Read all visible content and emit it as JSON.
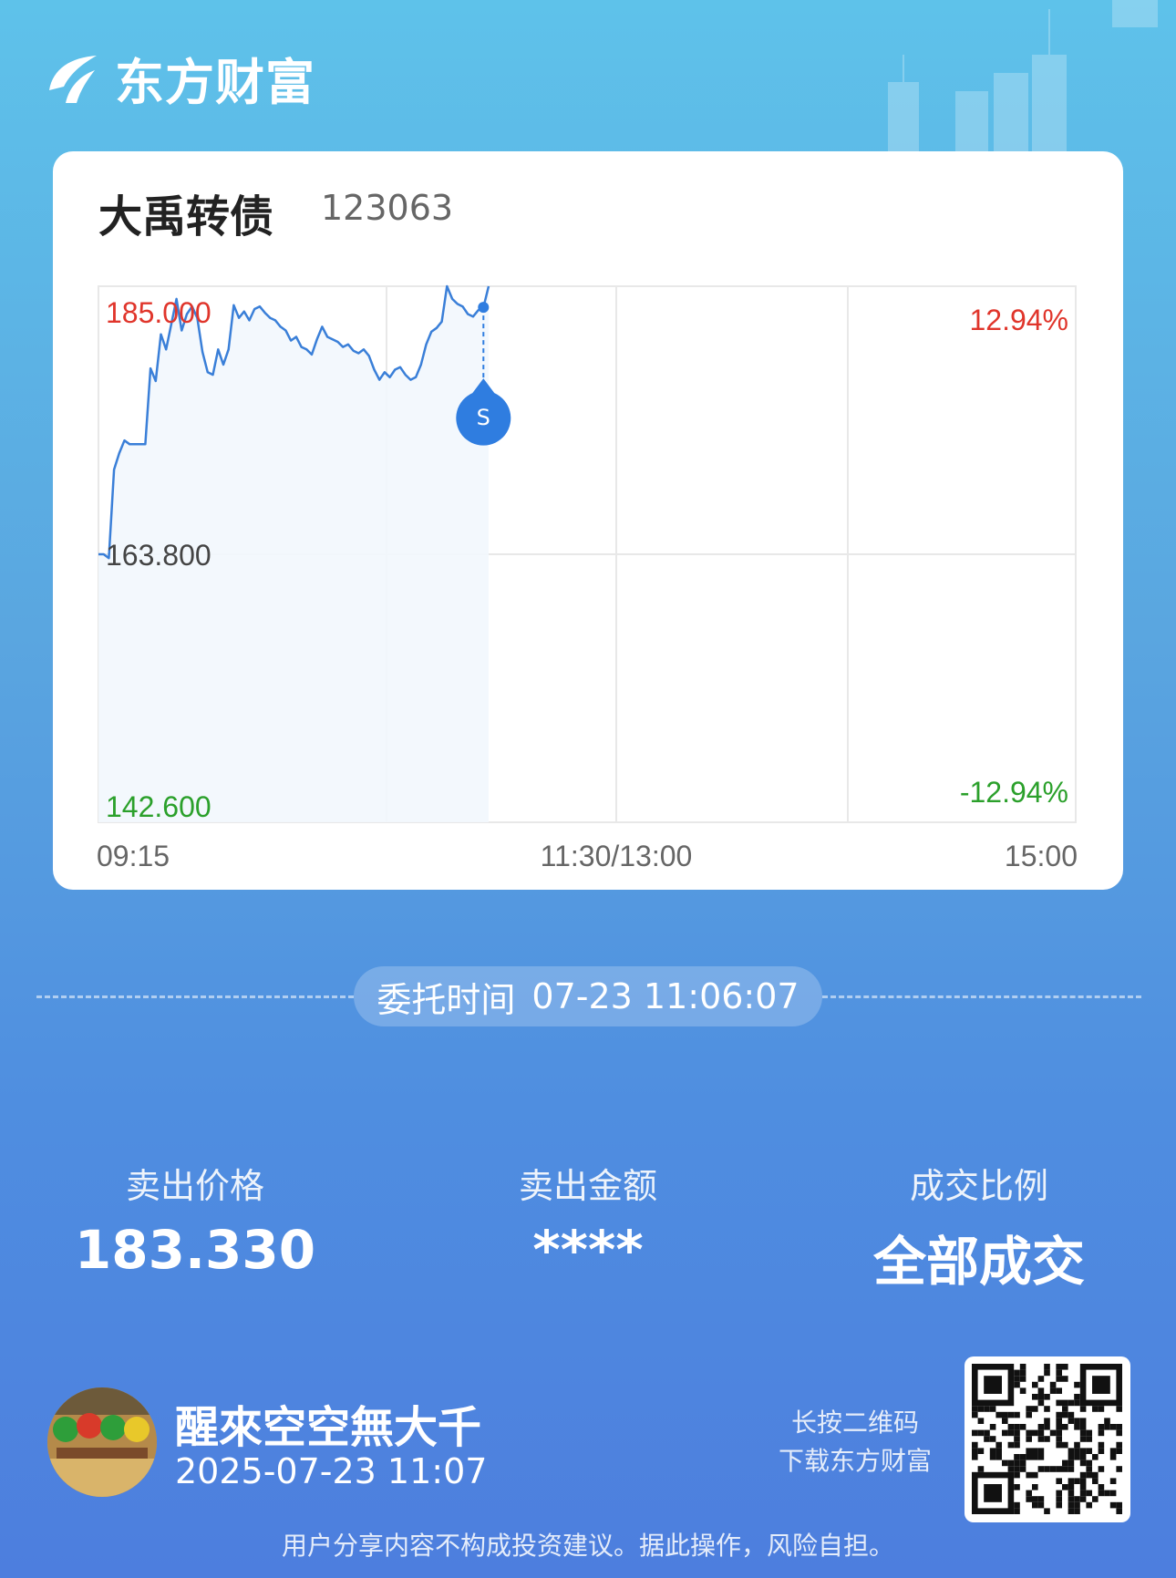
{
  "app": {
    "brand_name": "东方财富"
  },
  "stock": {
    "name": "大禹转债",
    "code": "123063"
  },
  "chart_data": {
    "type": "line",
    "y_labels": {
      "top": "185.000",
      "mid": "163.800",
      "bottom": "142.600"
    },
    "pct_labels": {
      "top": "12.94%",
      "bottom": "-12.94%"
    },
    "x_labels": {
      "start": "09:15",
      "mid": "11:30/13:00",
      "end": "15:00"
    },
    "ylim": [
      142.6,
      185.0
    ],
    "base_price": 163.8,
    "price_series": [
      163.8,
      163.8,
      163.5,
      170.5,
      171.8,
      172.8,
      172.5,
      172.5,
      172.5,
      172.5,
      178.5,
      177.5,
      181.2,
      180.0,
      182.0,
      184.0,
      181.5,
      182.8,
      183.4,
      182.5,
      179.8,
      178.2,
      178.0,
      180.0,
      178.8,
      180.0,
      183.5,
      182.5,
      183.0,
      182.3,
      183.2,
      183.4,
      182.9,
      182.5,
      182.3,
      181.8,
      181.5,
      180.7,
      181.0,
      180.2,
      180.0,
      179.6,
      180.8,
      181.8,
      181.0,
      180.8,
      180.6,
      180.2,
      180.4,
      179.9,
      179.7,
      180.0,
      179.5,
      178.4,
      177.6,
      178.2,
      177.8,
      178.4,
      178.6,
      178.0,
      177.6,
      177.8,
      178.8,
      180.4,
      181.4,
      181.7,
      182.2,
      185.0,
      184.0,
      183.6,
      183.4,
      182.8,
      182.6,
      183.1,
      183.33,
      185.0
    ],
    "sell_marker": {
      "label": "S",
      "price": 183.33
    },
    "series": [
      {
        "name": "",
        "color": "#3a7fd8"
      }
    ],
    "grid": true
  },
  "order": {
    "label": "委托时间",
    "time": "07-23 11:06:07"
  },
  "stats": {
    "price_label": "卖出价格",
    "price_value": "183.330",
    "amount_label": "卖出金额",
    "amount_value": "****",
    "ratio_label": "成交比例",
    "ratio_value": "全部成交"
  },
  "user": {
    "name": "醒來空空無大千",
    "time": "2025-07-23 11:07"
  },
  "qr": {
    "hint_line1": "长按二维码",
    "hint_line2": "下载东方财富"
  },
  "footer": {
    "disclaimer": "用户分享内容不构成投资建议。据此操作，风险自担。"
  },
  "colors": {
    "up": "#e0352b",
    "down": "#2ba02b",
    "line": "#3a7fd8",
    "marker": "#2f7de0"
  }
}
